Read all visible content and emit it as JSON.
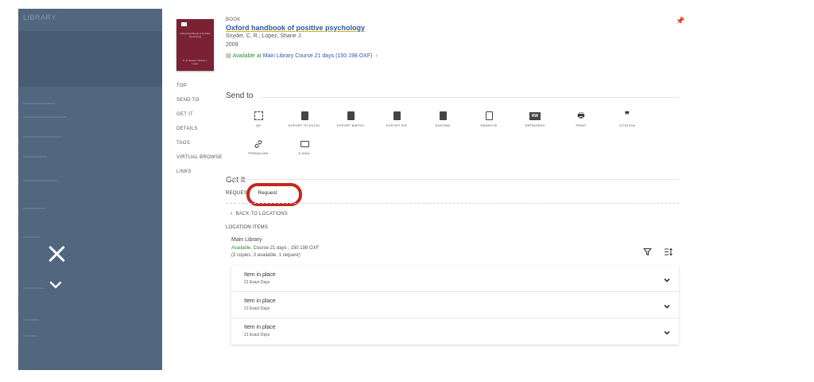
{
  "sidebar": {
    "brand": "LIBRARY"
  },
  "record": {
    "type": "BOOK",
    "title": "Oxford handbook of positive psychology",
    "authors": "Snyder, C. R.; Lopez, Shane J.",
    "year": "2009",
    "availability_status": "Available at",
    "availability_location": "Main Library  Course 21 days  (150.198 OXF)",
    "cover_title": "Oxford Handbook of Positive Psychology",
    "cover_authors": "C. R. Snyder / Shane J. Lopez"
  },
  "nav": [
    "TOP",
    "SEND TO",
    "GET IT",
    "DETAILS",
    "TAGS",
    "VIRTUAL BROWSE",
    "LINKS"
  ],
  "send_to": {
    "title": "Send to",
    "actions": [
      {
        "label": "QR",
        "icon": "qr-icon"
      },
      {
        "label": "EXPORT TO EXCEL",
        "icon": "excel-icon"
      },
      {
        "label": "EXPORT BIBTEX",
        "icon": "bibtex-icon"
      },
      {
        "label": "EXPORT RIS",
        "icon": "ris-icon"
      },
      {
        "label": "EASYBIB",
        "icon": "easybib-icon"
      },
      {
        "label": "ENDNOTE",
        "icon": "endnote-icon"
      },
      {
        "label": "REFWORKS",
        "icon": "refworks-icon"
      },
      {
        "label": "PRINT",
        "icon": "print-icon"
      },
      {
        "label": "CITATION",
        "icon": "quote-icon"
      },
      {
        "label": "PERMALINK",
        "icon": "link-icon"
      },
      {
        "label": "E-MAIL",
        "icon": "mail-icon"
      }
    ],
    "refworks_glyph": "RW"
  },
  "get_it": {
    "title": "Get It",
    "request_label": "REQUEST:",
    "request_tab": "Request",
    "back_label": "BACK TO LOCATIONS",
    "location_items_label": "LOCATION ITEMS",
    "library_name": "Main Library",
    "library_available": "Available",
    "library_details": ", Course 21 days ; 150.198 OXF",
    "library_copies": "(3 copies, 3 available, 1 request)",
    "items": [
      {
        "status": "Item in place",
        "policy": "21 Exact Days"
      },
      {
        "status": "Item in place",
        "policy": "21 Exact Days"
      },
      {
        "status": "Item in place",
        "policy": "21 Exact Days"
      }
    ]
  },
  "colors": {
    "overlay": "#51667f",
    "link": "#2a5aa8",
    "available": "#2f8a35",
    "highlight": "#c8261b"
  }
}
